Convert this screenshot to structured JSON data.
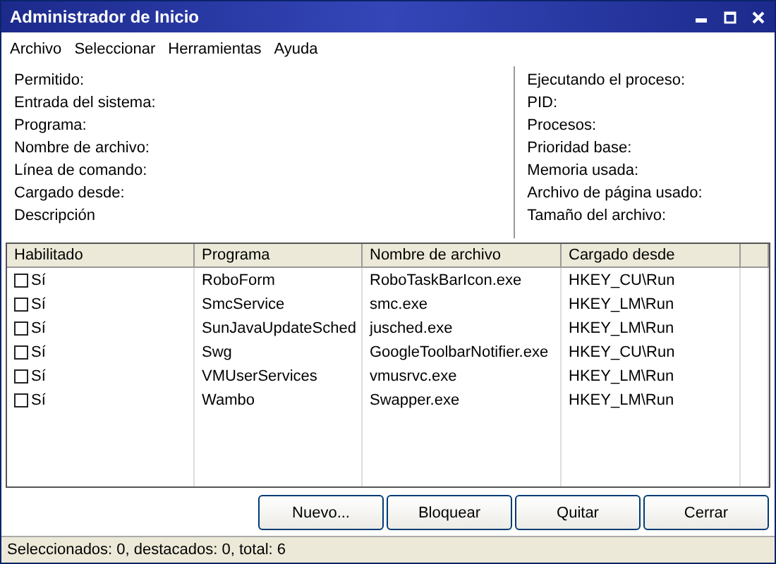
{
  "window": {
    "title": "Administrador de Inicio"
  },
  "menu": [
    "Archivo",
    "Seleccionar",
    "Herramientas",
    "Ayuda"
  ],
  "details_left": [
    "Permitido:",
    "Entrada del sistema:",
    "Programa:",
    "Nombre de archivo:",
    "Línea de comando:",
    "Cargado desde:",
    "Descripción"
  ],
  "details_right": [
    "Ejecutando el proceso:",
    "PID:",
    "Procesos:",
    "Prioridad base:",
    "Memoria usada:",
    "Archivo de página usado:",
    "Tamaño del archivo:"
  ],
  "table": {
    "columns": [
      "Habilitado",
      "Programa",
      "Nombre de archivo",
      "Cargado desde"
    ],
    "rows": [
      {
        "checked": false,
        "enabled": "Sí",
        "program": "RoboForm",
        "file": "RoboTaskBarIcon.exe",
        "loaded_from": "HKEY_CU\\Run"
      },
      {
        "checked": false,
        "enabled": "Sí",
        "program": "SmcService",
        "file": "smc.exe",
        "loaded_from": "HKEY_LM\\Run"
      },
      {
        "checked": false,
        "enabled": "Sí",
        "program": "SunJavaUpdateSched",
        "file": "jusched.exe",
        "loaded_from": "HKEY_LM\\Run"
      },
      {
        "checked": false,
        "enabled": "Sí",
        "program": "Swg",
        "file": "GoogleToolbarNotifier.exe",
        "loaded_from": "HKEY_CU\\Run"
      },
      {
        "checked": false,
        "enabled": "Sí",
        "program": "VMUserServices",
        "file": "vmusrvc.exe",
        "loaded_from": "HKEY_LM\\Run"
      },
      {
        "checked": false,
        "enabled": "Sí",
        "program": "Wambo",
        "file": "Swapper.exe",
        "loaded_from": "HKEY_LM\\Run"
      }
    ]
  },
  "buttons": [
    "Nuevo...",
    "Bloquear",
    "Quitar",
    "Cerrar"
  ],
  "status_bar": "Seleccionados: 0, destacados: 0, total: 6"
}
